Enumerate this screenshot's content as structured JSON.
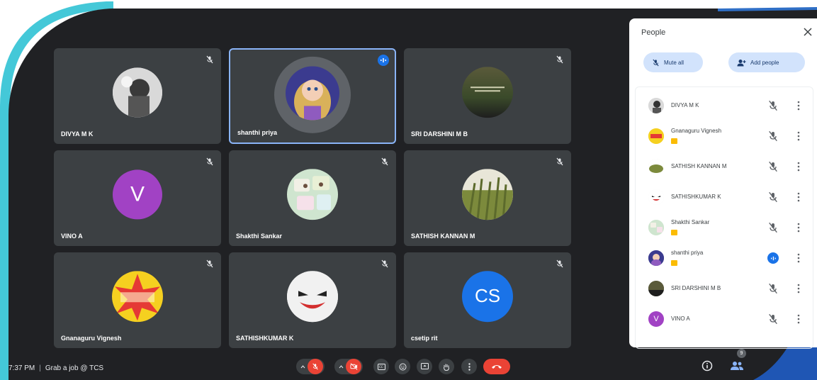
{
  "tiles": [
    {
      "name": "DIVYA M K"
    },
    {
      "name": "shanthi priya"
    },
    {
      "name": "SRI DARSHINI M B"
    },
    {
      "name": "VINO A",
      "initial": "V"
    },
    {
      "name": "Shakthi Sankar"
    },
    {
      "name": "SATHISH KANNAN M"
    },
    {
      "name": "Gnanaguru Vignesh"
    },
    {
      "name": "SATHISHKUMAR K"
    },
    {
      "name": "csetip rit",
      "initial": "CS"
    }
  ],
  "bottom": {
    "time": "7:37 PM",
    "separator": "|",
    "meeting": "Grab a job @ TCS"
  },
  "people": {
    "title": "People",
    "mute_all": "Mute all",
    "add_people": "Add people",
    "list": [
      {
        "name": "DIVYA M K"
      },
      {
        "name": "Gnanaguru Vignesh"
      },
      {
        "name": "SATHISH KANNAN M"
      },
      {
        "name": "SATHISHKUMAR K"
      },
      {
        "name": "Shakthi Sankar"
      },
      {
        "name": "shanthi priya"
      },
      {
        "name": "SRI DARSHINI M B"
      },
      {
        "name": "VINO A",
        "initial": "V"
      }
    ]
  },
  "badge_count": "9",
  "colors": {
    "background": "#202124",
    "tile": "#3c4043",
    "accent": "#1a73e8",
    "red": "#ea4335",
    "vino": "#a142c4",
    "cs": "#1a73e8"
  }
}
